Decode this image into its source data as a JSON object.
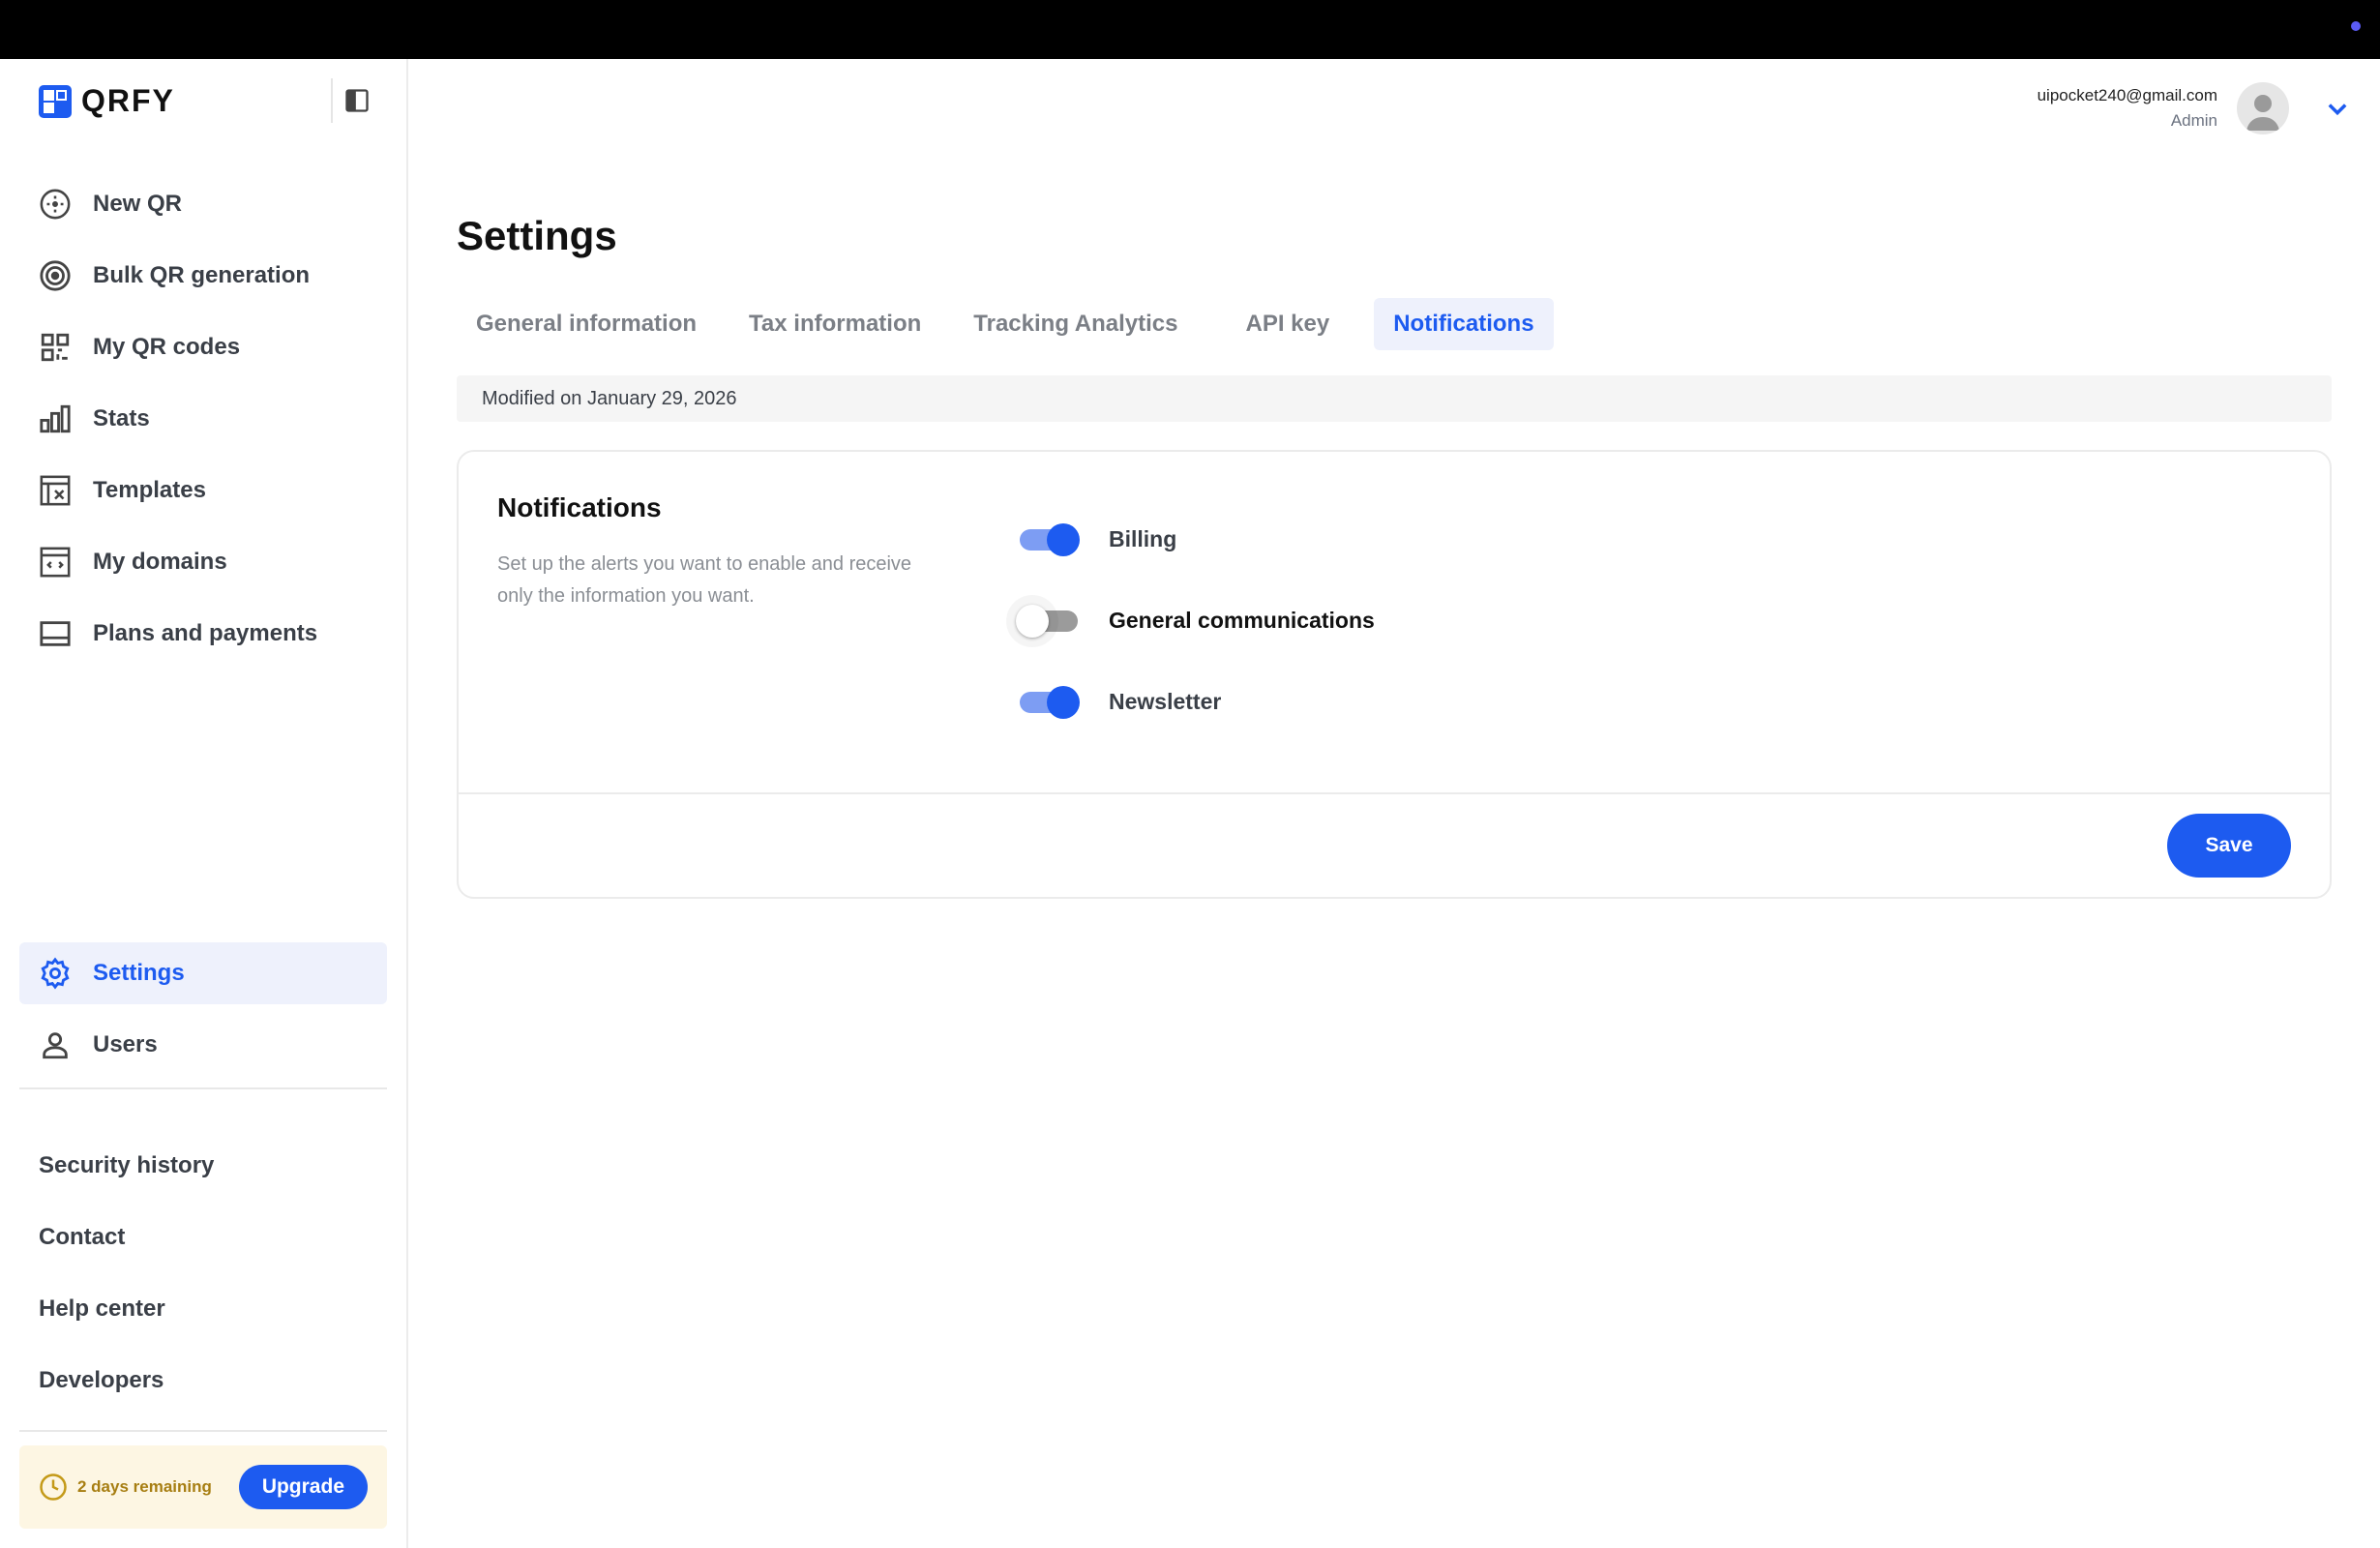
{
  "app": {
    "name": "QRFY"
  },
  "colors": {
    "accent": "#1d5bf0",
    "accent_light": "#eef1fc",
    "trial_bg": "#fdf6e3",
    "trial_text": "#a77e12"
  },
  "sidebar": {
    "collapse_icon": "sidebar-toggle-icon",
    "items": [
      {
        "label": "New QR",
        "icon": "plus-circle-icon"
      },
      {
        "label": "Bulk QR generation",
        "icon": "target-icon"
      },
      {
        "label": "My QR codes",
        "icon": "qr-code-icon"
      },
      {
        "label": "Stats",
        "icon": "bar-chart-icon"
      },
      {
        "label": "Templates",
        "icon": "template-icon"
      },
      {
        "label": "My domains",
        "icon": "domain-icon"
      },
      {
        "label": "Plans and payments",
        "icon": "card-icon"
      }
    ],
    "bottom_items": [
      {
        "label": "Settings",
        "icon": "gear-icon",
        "active": true
      },
      {
        "label": "Users",
        "icon": "user-icon"
      }
    ],
    "links": [
      {
        "label": "Security history"
      },
      {
        "label": "Contact"
      },
      {
        "label": "Help center"
      },
      {
        "label": "Developers"
      }
    ],
    "trial": {
      "text": "2 days remaining",
      "button": "Upgrade",
      "icon": "clock-icon"
    }
  },
  "header": {
    "email": "uipocket240@gmail.com",
    "role": "Admin",
    "menu_icon": "chevron-down-icon"
  },
  "main": {
    "title": "Settings",
    "tabs": [
      {
        "label": "General information"
      },
      {
        "label": "Tax information"
      },
      {
        "label": "Tracking Analytics"
      },
      {
        "label": "API key"
      },
      {
        "label": "Notifications",
        "active": true
      }
    ],
    "modified": "Modified on January 29, 2026",
    "card": {
      "title": "Notifications",
      "description": "Set up the alerts you want to enable and receive only the information you want.",
      "toggles": [
        {
          "label": "Billing",
          "on": true
        },
        {
          "label": "General communications",
          "on": false
        },
        {
          "label": "Newsletter",
          "on": true
        }
      ],
      "save_label": "Save"
    }
  }
}
